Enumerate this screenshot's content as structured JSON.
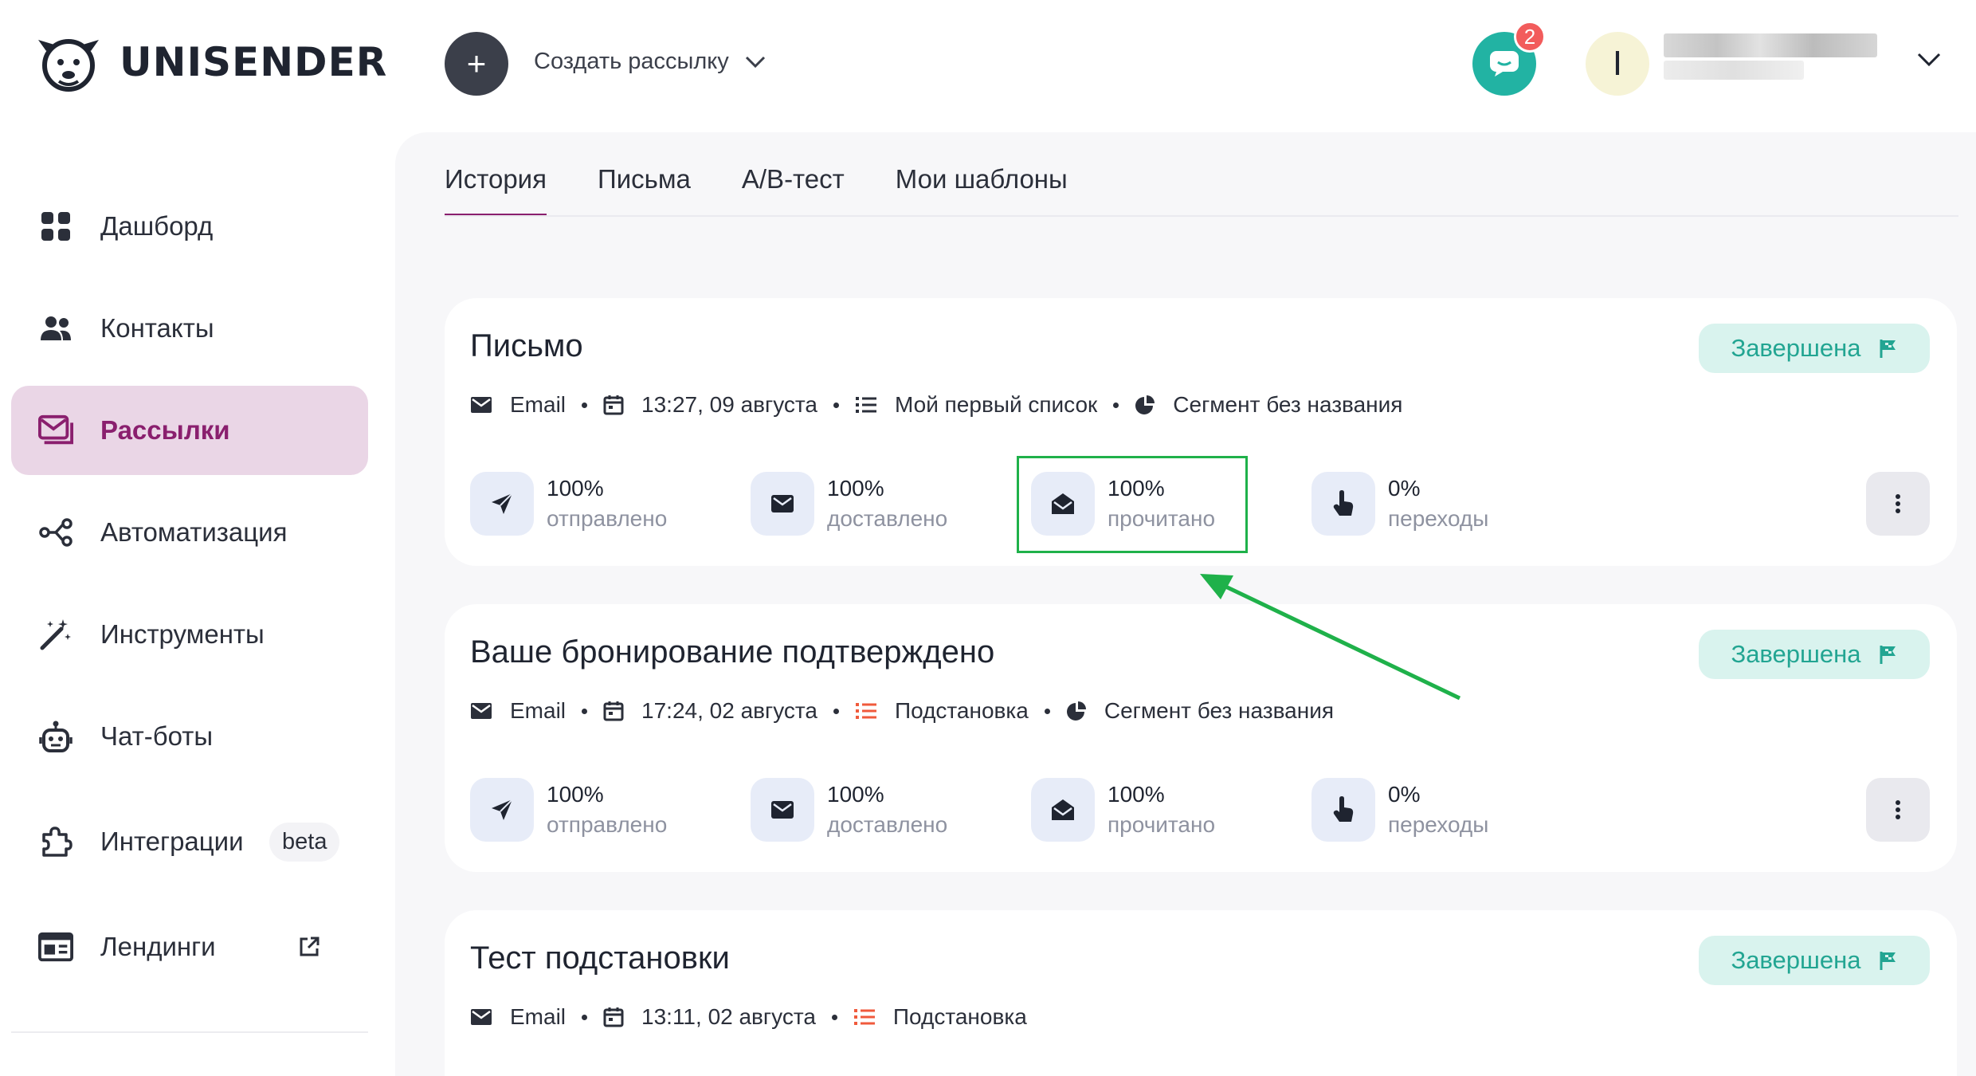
{
  "brand": {
    "name": "UNISENDER"
  },
  "header": {
    "create_icon": "+",
    "create_label": "Создать рассылку",
    "chat_badge": "2",
    "avatar_initial": "I"
  },
  "sidebar": {
    "items": [
      {
        "label": "Дашборд",
        "icon": "dashboard-icon"
      },
      {
        "label": "Контакты",
        "icon": "contacts-icon"
      },
      {
        "label": "Рассылки",
        "icon": "mailings-icon",
        "active": true
      },
      {
        "label": "Автоматизация",
        "icon": "automation-icon"
      },
      {
        "label": "Инструменты",
        "icon": "magic-wand-icon"
      },
      {
        "label": "Чат-боты",
        "icon": "robot-icon"
      },
      {
        "label": "Интеграции",
        "icon": "puzzle-icon",
        "badge": "beta"
      },
      {
        "label": "Лендинги",
        "icon": "landing-icon"
      }
    ]
  },
  "tabs": [
    {
      "label": "История",
      "active": true
    },
    {
      "label": "Письма"
    },
    {
      "label": "A/B-тест"
    },
    {
      "label": "Мои шаблоны"
    }
  ],
  "campaigns": [
    {
      "title": "Письмо",
      "status": "Завершена",
      "channel": "Email",
      "datetime": "13:27, 09 августа",
      "list": "Мой первый список",
      "segment": "Сегмент без названия",
      "stats": [
        {
          "value": "100%",
          "label": "отправлено"
        },
        {
          "value": "100%",
          "label": "доставлено"
        },
        {
          "value": "100%",
          "label": "прочитано"
        },
        {
          "value": "0%",
          "label": "переходы"
        }
      ]
    },
    {
      "title": "Ваше бронирование подтверждено",
      "status": "Завершена",
      "channel": "Email",
      "datetime": "17:24, 02 августа",
      "list": "Подстановка",
      "segment": "Сегмент без названия",
      "stats": [
        {
          "value": "100%",
          "label": "отправлено"
        },
        {
          "value": "100%",
          "label": "доставлено"
        },
        {
          "value": "100%",
          "label": "прочитано"
        },
        {
          "value": "0%",
          "label": "переходы"
        }
      ]
    },
    {
      "title": "Тест подстановки",
      "status": "Завершена",
      "channel": "Email",
      "datetime": "13:11, 02 августа",
      "list": "Подстановка"
    }
  ],
  "colors": {
    "accent": "#8a1f6e",
    "active_bg": "#ead6e6",
    "status_bg": "#d9f3ee",
    "status_text": "#22a592",
    "highlight": "#1fb14a",
    "chat": "#22b3a3",
    "list_icon_red": "#f05a3c"
  }
}
